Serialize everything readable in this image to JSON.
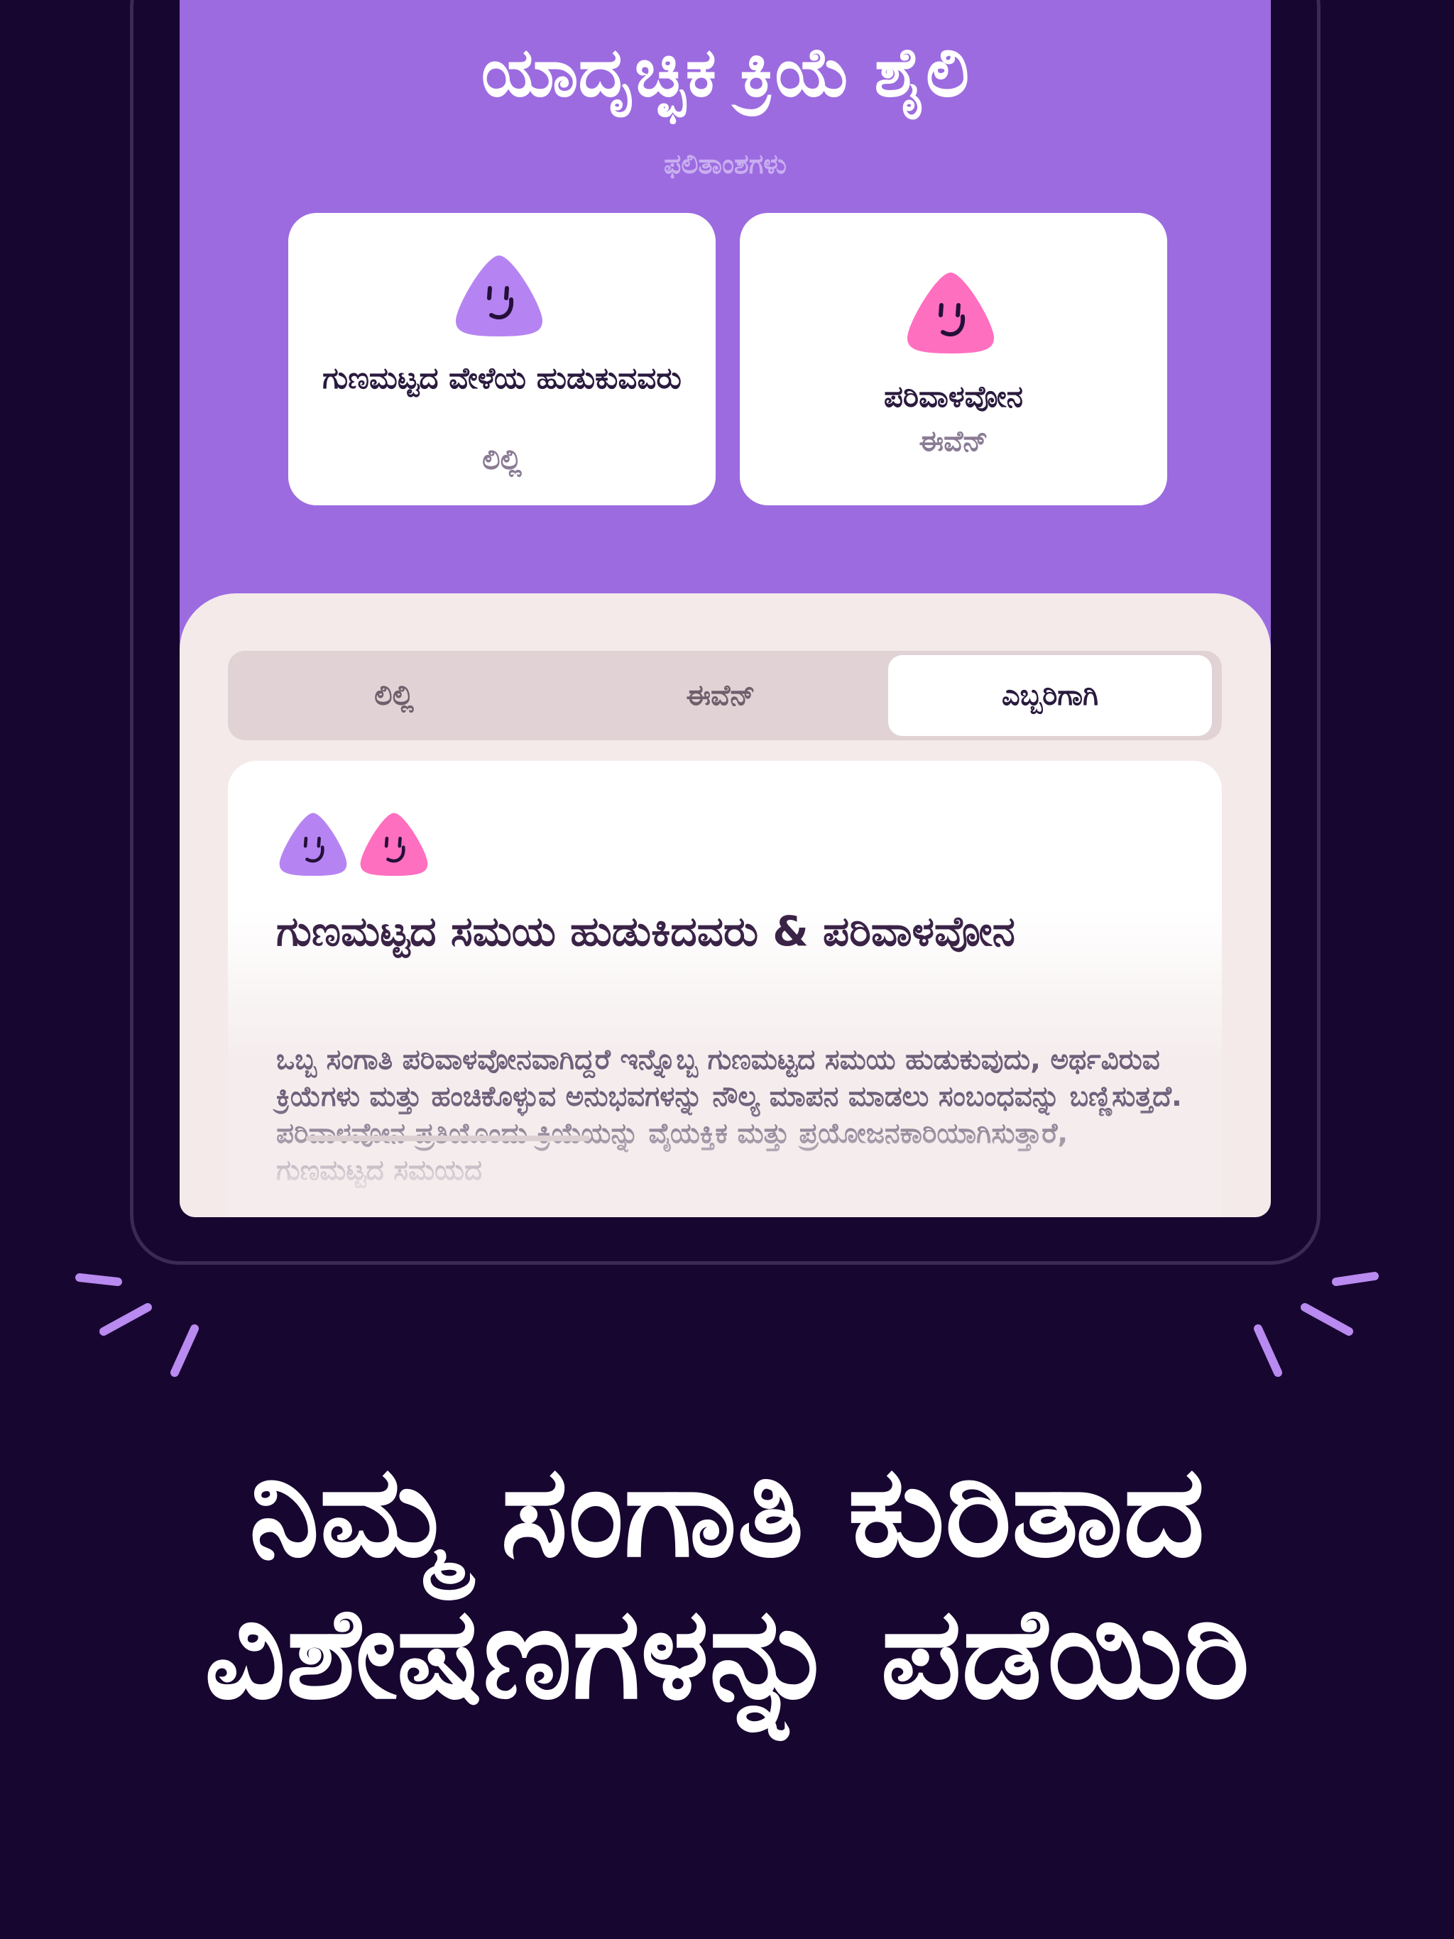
{
  "header": {
    "title": "ಯಾದೃಚ್ಛಿಕ ಕ್ರಿಯೆ ಶೈಲಿ",
    "subtitle": "ಫಲಿತಾಂಶಗಳು"
  },
  "results": [
    {
      "name": "ಗುಣಮಟ್ಟದ ವೇಳೆಯ ಹುಡುಕುವವರು",
      "person": "ಲಿಲ್ಲಿ",
      "color": "#b684f2",
      "icon": "smiley-blob-icon"
    },
    {
      "name": "ಪರಿವಾಳವೋನ",
      "person": "ಈವೆನ್",
      "color": "#ff6fbf",
      "icon": "smiley-blob-icon"
    }
  ],
  "tabs": [
    {
      "label": "ಲಿಲ್ಲಿ",
      "selected": false
    },
    {
      "label": "ಈವೆನ್",
      "selected": false
    },
    {
      "label": "ಎಬ್ಬರಿಗಾಗಿ",
      "selected": true
    }
  ],
  "result_card": {
    "title": "ಗುಣಮಟ್ಟದ ಸಮಯ ಹುಡುಕಿದವರು & ಪರಿವಾಳವೋನ",
    "text": "ಒಬ್ಬ ಸಂಗಾತಿ ಪರಿವಾಳವೋನವಾಗಿದ್ದರೆ ಇನ್ನೊಬ್ಬ ಗುಣಮಟ್ಟದ ಸಮಯ ಹುಡುಕುವುದು, ಅರ್ಥವಿರುವ ಕ್ರಿಯೆಗಳು ಮತ್ತು ಹಂಚಿಕೊಳ್ಳುವ ಅನುಭವಗಳನ್ನು ನೌಲ್ಯ ಮಾಪನ ಮಾಡಲು ಸಂಬಂಧವನ್ನು ಬಣ್ಣಿಸುತ್ತದೆ. ಪರಿವಾಳವೋನ ಪ್ರತಿಯೊಂದು ಕ್ರಿಯೆಯನ್ನು ವೈಯಕ್ತಿಕ ಮತ್ತು ಪ್ರಯೋಜನಕಾರಿಯಾಗಿಸುತ್ತಾರೆ, ಗುಣಮಟ್ಟದ ಸಮಯದ"
  },
  "headline": "ನಿಮ್ಮ ಸಂಗಾತಿ ಕುರಿತಾದ ವಿಶೇಷಣಗಳನ್ನು ಪಡೆಯಿರಿ",
  "colors": {
    "background": "#170630",
    "purple": "#9c6be0",
    "sheet": "#f4eaea",
    "spark": "#b98af0"
  }
}
